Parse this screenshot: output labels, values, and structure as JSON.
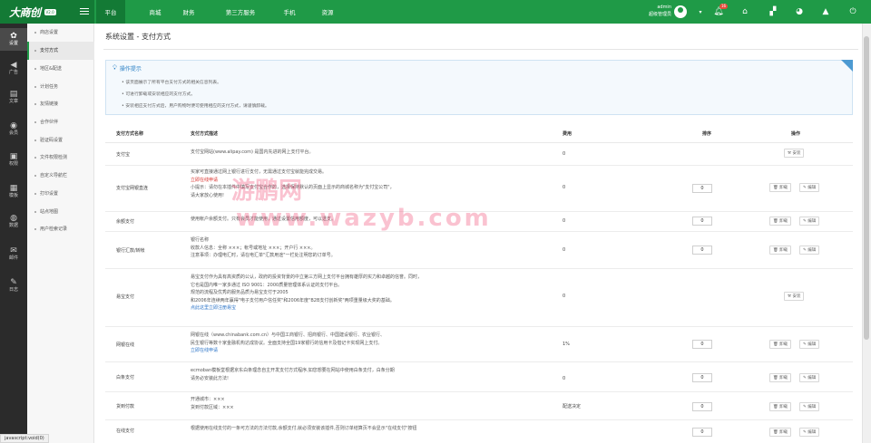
{
  "brand": {
    "logo": "大商创",
    "version": "V2.0"
  },
  "nav": [
    {
      "label": "平台",
      "active": true
    },
    {
      "label": "商城"
    },
    {
      "label": "财务"
    },
    {
      "label": "第三方服务"
    },
    {
      "label": "手机"
    },
    {
      "label": "资源"
    }
  ],
  "user": {
    "name": "admin",
    "role": "超级管理员",
    "notifications": "16"
  },
  "iconbar": [
    {
      "icon": "✿",
      "label": "设置"
    },
    {
      "icon": "◀",
      "label": "广告"
    },
    {
      "icon": "▤",
      "label": "文章"
    },
    {
      "icon": "◉",
      "label": "会员"
    },
    {
      "icon": "▣",
      "label": "权限"
    },
    {
      "icon": "▦",
      "label": "模板"
    },
    {
      "icon": "◍",
      "label": "数据"
    },
    {
      "icon": "✉",
      "label": "邮件"
    },
    {
      "icon": "✎",
      "label": "日志"
    }
  ],
  "subnav": [
    "商店设置",
    "支付方式",
    "地区&配送",
    "计划任务",
    "友情链接",
    "合作伙伴",
    "验证码设置",
    "文件权限检测",
    "自定义导航栏",
    "打印设置",
    "站点地图",
    "用户检索记录"
  ],
  "page": {
    "title": "系统设置 - 支付方式"
  },
  "tips": {
    "title": "操作提示",
    "lines": [
      "该页面展示了所有平台支付方式的相关信息列表。",
      "可进行卸载或安装相应的支付方式。",
      "安装相应支付方式后，用户购物时便可使用相应的支付方式，请谨慎卸载。"
    ]
  },
  "table": {
    "headers": {
      "name": "支付方式名称",
      "desc": "支付方式描述",
      "fee": "费用",
      "order": "排序",
      "ops": "操作"
    },
    "buttons": {
      "install": "安装",
      "uninstall": "卸载",
      "edit": "编辑"
    },
    "rows": [
      {
        "name": "支付宝",
        "desc": [
          "支付宝网站(www.alipay.com) 是国内先进的网上支付平台。"
        ],
        "fee": "0",
        "installed": false
      },
      {
        "name": "支付宝网银直连",
        "desc": [
          "买家可直接通过网上银行进行支付，无需通过支付宝就能完成交易。",
          "立即在线申请",
          "小提示：请勿在本插件中填写支付宝合作的，选择保持默认的页面上显示的商城名称为\"支付宝公司\"，",
          "请大家放心使用!"
        ],
        "fee": "0",
        "order": "0",
        "installed": true
      },
      {
        "name": "余额支付",
        "desc": [
          "使用帐户余额支付。只有会员才能使用，通过设置信用额度，可以透支。"
        ],
        "fee": "0",
        "order": "0",
        "installed": true
      },
      {
        "name": "银行汇款/转帐",
        "desc": [
          "银行名称",
          "收款人信息：全称 ×××；帐号或地址 ×××；开户行 ×××。",
          "注意事项：办理电汇时，请在电汇单\"汇款用途\"一栏处注明您的订单号。"
        ],
        "fee": "0",
        "order": "0",
        "installed": true
      },
      {
        "name": "易宝支付",
        "desc": [
          "易宝支付作为具有高资质的公认，政府的投资背景的中立第三方网上支付平台拥有雄厚的实力和卓越的信誉。同时，",
          "它也是国内唯一家多通过 ISO 9001：2000质量管理体系认证的支付平台。",
          "规范的流程及优秀的服务品质为易宝支付于2005",
          "和2006年连续两年赢得\"电子支付用户信任奖\"和2006年度\"B2B支付创新奖\"两项重量级大奖的基础。",
          "点此这里立即注册易宝"
        ],
        "fee": "0",
        "installed": false
      },
      {
        "name": "网银在线",
        "desc": [
          "网银在线（www.chinabank.com.cn）与中国工商银行、招商银行、中国建设银行、农业银行、",
          "民生银行等数十家金融机构达成协议。全面支持全国19家银行的信用卡及借记卡实现网上支付。",
          "立即在线申请"
        ],
        "fee": "1%",
        "order": "0",
        "installed": true
      },
      {
        "name": "白条支付",
        "desc": [
          "ecmoban模板堂根据京东白条理念自主开发支付方式程序,如您想要在网站中使用白条支付，白条分期",
          "请务必安装此方法!"
        ],
        "fee": "0",
        "order": "0",
        "installed": true
      },
      {
        "name": "货到付款",
        "desc": [
          "开通城市：×××",
          "货到付款区域：×××"
        ],
        "fee": "配送决定",
        "order": "0",
        "installed": true
      },
      {
        "name": "在线支付",
        "desc": [
          "根据使用在线支付的一条可方法的方法付款,余额支付,就必须安装该插件,否则订单结算页不会显示\"在线支付\"按钮"
        ],
        "fee": "",
        "order": "0",
        "installed": true
      }
    ]
  },
  "watermark": {
    "cn": "游鹏网",
    "url": "www.wazyb.com"
  },
  "status": {
    "text": "javascript:void(0)"
  }
}
